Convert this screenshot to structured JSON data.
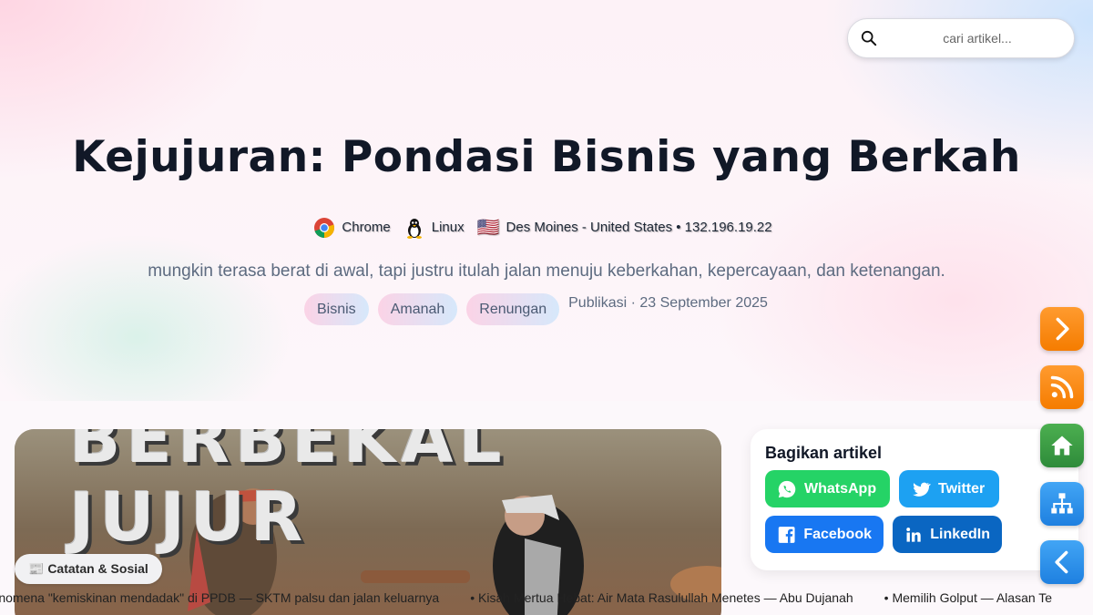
{
  "search": {
    "placeholder": "cari artikel..."
  },
  "article": {
    "title": "Kejujuran: Pondasi Bisnis yang Berkah",
    "subtitle": "mungkin terasa berat di awal, tapi justru itulah jalan menuju keberkahan, kepercayaan, dan ketenangan.",
    "tags": [
      "Bisnis",
      "Amanah",
      "Renungan"
    ],
    "published": "Publikasi · 23 September 2025",
    "category": "📰 Catatan & Sosial",
    "image_banner_text": "BERBEKAL JUJUR"
  },
  "visitor": {
    "browser": "Chrome",
    "os": "Linux",
    "flag": "🇺🇸",
    "location": "Des Moines - United States • 132.196.19.22"
  },
  "share": {
    "title": "Bagikan artikel",
    "whatsapp": "WhatsApp",
    "twitter": "Twitter",
    "facebook": "Facebook",
    "linkedin": "LinkedIn"
  },
  "side_buttons": [
    "chevron-right-icon",
    "rss-icon",
    "home-icon",
    "sitemap-icon",
    "chevron-left-icon"
  ],
  "ticker": [
    "Fenomena \"kemiskinan mendadak\" di PPDB — SKTM palsu dan jalan keluarnya",
    "Kisah Mertua Hebat: Air Mata Rasulullah Menetes — Abu Dujanah",
    "Memilih Golput — Alasan Te"
  ],
  "colors": {
    "title": "#111827",
    "whatsapp": "#25d366",
    "twitter": "#1da1f2",
    "facebook": "#1877f2",
    "linkedin": "#0a66c2",
    "fab_orange": "#f57c00",
    "fab_green": "#2e8b3a",
    "fab_blue": "#1e80e0"
  }
}
